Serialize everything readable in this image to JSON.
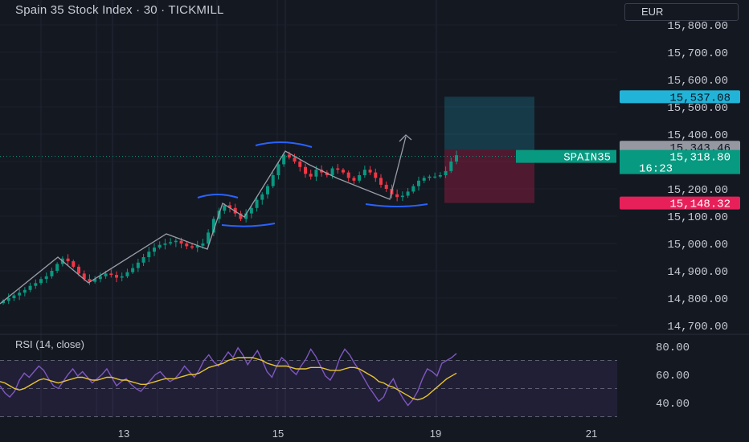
{
  "header": {
    "title": "Spain 35 Stock Index · 30 · TICKMILL",
    "currency": "EUR"
  },
  "rsi": {
    "label": "RSI (14, close)",
    "ticks": [
      "80.00",
      "60.00",
      "40.00"
    ],
    "rsi_values": [
      52,
      47,
      44,
      48,
      56,
      61,
      58,
      62,
      66,
      63,
      57,
      52,
      50,
      55,
      60,
      64,
      59,
      62,
      58,
      54,
      57,
      60,
      64,
      58,
      52,
      55,
      57,
      53,
      50,
      48,
      52,
      56,
      60,
      62,
      58,
      55,
      57,
      61,
      66,
      62,
      58,
      63,
      70,
      74,
      69,
      66,
      71,
      76,
      72,
      79,
      74,
      67,
      72,
      77,
      70,
      62,
      58,
      66,
      72,
      69,
      63,
      60,
      66,
      71,
      78,
      73,
      66,
      59,
      56,
      62,
      72,
      78,
      74,
      68,
      63,
      57,
      51,
      46,
      41,
      44,
      52,
      57,
      49,
      43,
      38,
      42,
      48,
      57,
      64,
      62,
      59,
      68,
      70,
      72,
      75
    ],
    "ma_values": [
      55,
      54,
      52,
      50,
      49,
      50,
      52,
      54,
      56,
      57,
      56,
      55,
      54,
      55,
      56,
      57,
      58,
      58,
      57,
      56,
      56,
      57,
      58,
      58,
      57,
      56,
      56,
      55,
      54,
      53,
      53,
      54,
      55,
      56,
      57,
      57,
      57,
      58,
      59,
      60,
      60,
      61,
      63,
      65,
      66,
      67,
      68,
      70,
      71,
      72,
      72,
      72,
      72,
      71,
      70,
      68,
      67,
      66,
      66,
      66,
      65,
      64,
      64,
      64,
      65,
      65,
      65,
      64,
      63,
      63,
      63,
      64,
      65,
      65,
      64,
      62,
      60,
      58,
      55,
      54,
      52,
      51,
      49,
      47,
      45,
      43,
      42,
      43,
      45,
      48,
      51,
      54,
      57,
      59,
      61
    ]
  },
  "y_ticks": [
    "15,800.00",
    "15,700.00",
    "15,600.00",
    "15,500.00",
    "15,400.00",
    "15,300.00",
    "15,200.00",
    "15,100.00",
    "15,000.00",
    "14,900.00",
    "14,800.00",
    "14,700.00"
  ],
  "x_ticks": [
    "13",
    "15",
    "19",
    "21"
  ],
  "price_labels": {
    "target": "15,537.08",
    "entry": "15,343.46",
    "current": "15,318.80",
    "countdown": "16:23",
    "stop": "15,148.32",
    "symbol": "SPAIN35"
  },
  "colors": {
    "background": "#141821",
    "up": "#089981",
    "down": "#f23645",
    "target": "#22b4d8",
    "stop": "#e8205a",
    "entry": "#9598a1",
    "current": "#089981",
    "annotation": "#2962ff",
    "rsi_line": "#7e57c2",
    "rsi_ma": "#e8c530"
  },
  "chart_data": [
    {
      "type": "candlestick",
      "title": "Spain 35 Stock Index · 30 · TICKMILL",
      "ylim": [
        14650,
        15860
      ],
      "yticks": [
        14700,
        14800,
        14900,
        15000,
        15100,
        15200,
        15300,
        15400,
        15500,
        15600,
        15700,
        15800
      ],
      "xticks": [
        "13",
        "15",
        "19",
        "21"
      ],
      "close": [
        14790,
        14800,
        14810,
        14820,
        14830,
        14845,
        14855,
        14870,
        14880,
        14900,
        14925,
        14945,
        14935,
        14915,
        14890,
        14870,
        14860,
        14870,
        14880,
        14890,
        14885,
        14875,
        14880,
        14895,
        14910,
        14930,
        14950,
        14970,
        14985,
        14995,
        15000,
        15005,
        15010,
        15000,
        14990,
        14985,
        14992,
        15000,
        15040,
        15090,
        15120,
        15140,
        15130,
        15110,
        15090,
        15110,
        15130,
        15160,
        15180,
        15210,
        15250,
        15290,
        15325,
        15315,
        15300,
        15280,
        15255,
        15245,
        15270,
        15260,
        15250,
        15275,
        15270,
        15260,
        15240,
        15230,
        15250,
        15270,
        15260,
        15240,
        15215,
        15200,
        15180,
        15170,
        15175,
        15190,
        15210,
        15230,
        15240,
        15245,
        15245,
        15250,
        15265,
        15300,
        15323
      ],
      "annotations": {
        "entry": 15343.46,
        "target": 15537.08,
        "stop": 15148.32,
        "current": 15318.8
      }
    },
    {
      "type": "line",
      "title": "RSI (14, close)",
      "ylim": [
        35,
        85
      ],
      "yticks": [
        40,
        60,
        80
      ],
      "bands": [
        50,
        70
      ]
    }
  ]
}
